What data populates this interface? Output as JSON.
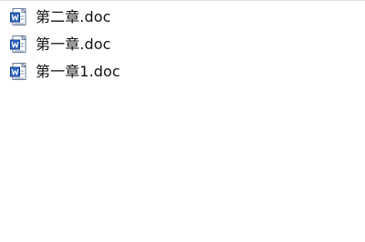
{
  "files": [
    {
      "name": "第二章.doc",
      "icon": "word-document-icon"
    },
    {
      "name": "第一章.doc",
      "icon": "word-document-icon"
    },
    {
      "name": "第一章1.doc",
      "icon": "word-document-icon"
    }
  ],
  "colors": {
    "icon_blue": "#2f66c4",
    "icon_dark_blue": "#143f8f",
    "page_white": "#ffffff",
    "text": "#111111"
  }
}
